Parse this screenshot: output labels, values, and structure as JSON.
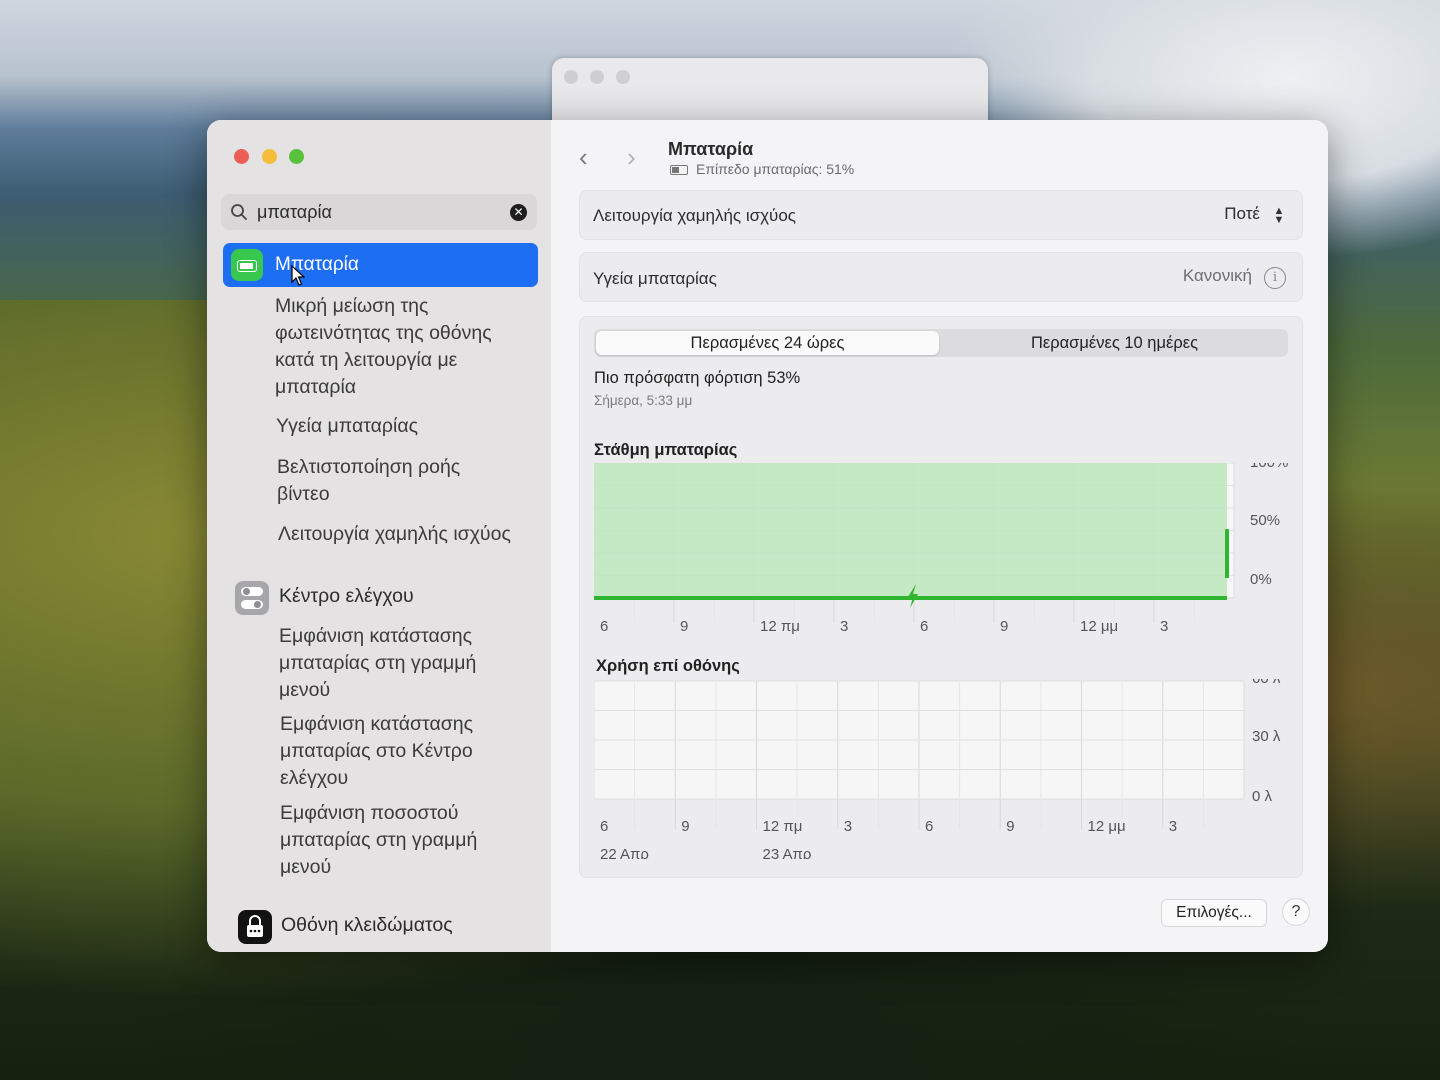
{
  "window": {
    "title": "Μπαταρία",
    "subtitle": "Επίπεδο μπαταρίας: 51%"
  },
  "sidebar": {
    "search_value": "μπαταρία",
    "selected": "Μπαταρία",
    "battery_sub": [
      "Μικρή μείωση της φωτεινότητας της οθόνης κατά τη λειτουργία με μπαταρία",
      "Υγεία μπαταρίας",
      "Βελτιστοποίηση ροής βίντεο",
      "Λειτουργία χαμηλής ισχύος"
    ],
    "control_center": "Κέντρο ελέγχου",
    "control_center_sub": [
      "Εμφάνιση κατάστασης μπαταρίας στη γραμμή μενού",
      "Εμφάνιση κατάστασης μπαταρίας στο Κέντρο ελέγχου",
      "Εμφάνιση ποσοστού μπαταρίας στη γραμμή μενού"
    ],
    "lock_screen": "Οθόνη κλειδώματος"
  },
  "settings": {
    "low_power_label": "Λειτουργία χαμηλής ισχύος",
    "low_power_value": "Ποτέ",
    "health_label": "Υγεία μπαταρίας",
    "health_value": "Κανονική"
  },
  "tabs": {
    "active": "Περασμένες 24 ώρες",
    "inactive": "Περασμένες 10 ημέρες"
  },
  "charge": {
    "title": "Πιο πρόσφατη φόρτιση 53%",
    "time": "Σήμερα, 5:33 μμ"
  },
  "buttons": {
    "options": "Επιλογές...",
    "help": "?"
  },
  "colors": {
    "accent": "#1d6ef2",
    "battery_fill": "#bfe6bf",
    "battery_line": "#2fb52f"
  },
  "chart_data": [
    {
      "type": "area",
      "title": "Στάθμη μπαταρίας",
      "x_ticks": [
        "6",
        "9",
        "12 πμ",
        "3",
        "6",
        "9",
        "12 μμ",
        "3"
      ],
      "y_ticks": [
        "100%",
        "50%",
        "0%"
      ],
      "ylim": [
        0,
        100
      ],
      "series": [
        {
          "values": [
            100,
            100,
            100,
            100,
            100,
            100,
            100,
            100,
            51
          ]
        }
      ]
    },
    {
      "type": "bar",
      "title": "Χρήση επί οθόνης",
      "x_ticks": [
        "6",
        "9",
        "12 πμ",
        "3",
        "6",
        "9",
        "12 μμ",
        "3"
      ],
      "date_labels": [
        "22 Απρ",
        "23 Απρ"
      ],
      "y_ticks": [
        "60 λ",
        "30 λ",
        "0 λ"
      ],
      "ylim": [
        0,
        60
      ],
      "series": [
        {
          "values": [
            0,
            0,
            0,
            0,
            0,
            0,
            0,
            0
          ]
        }
      ]
    }
  ]
}
